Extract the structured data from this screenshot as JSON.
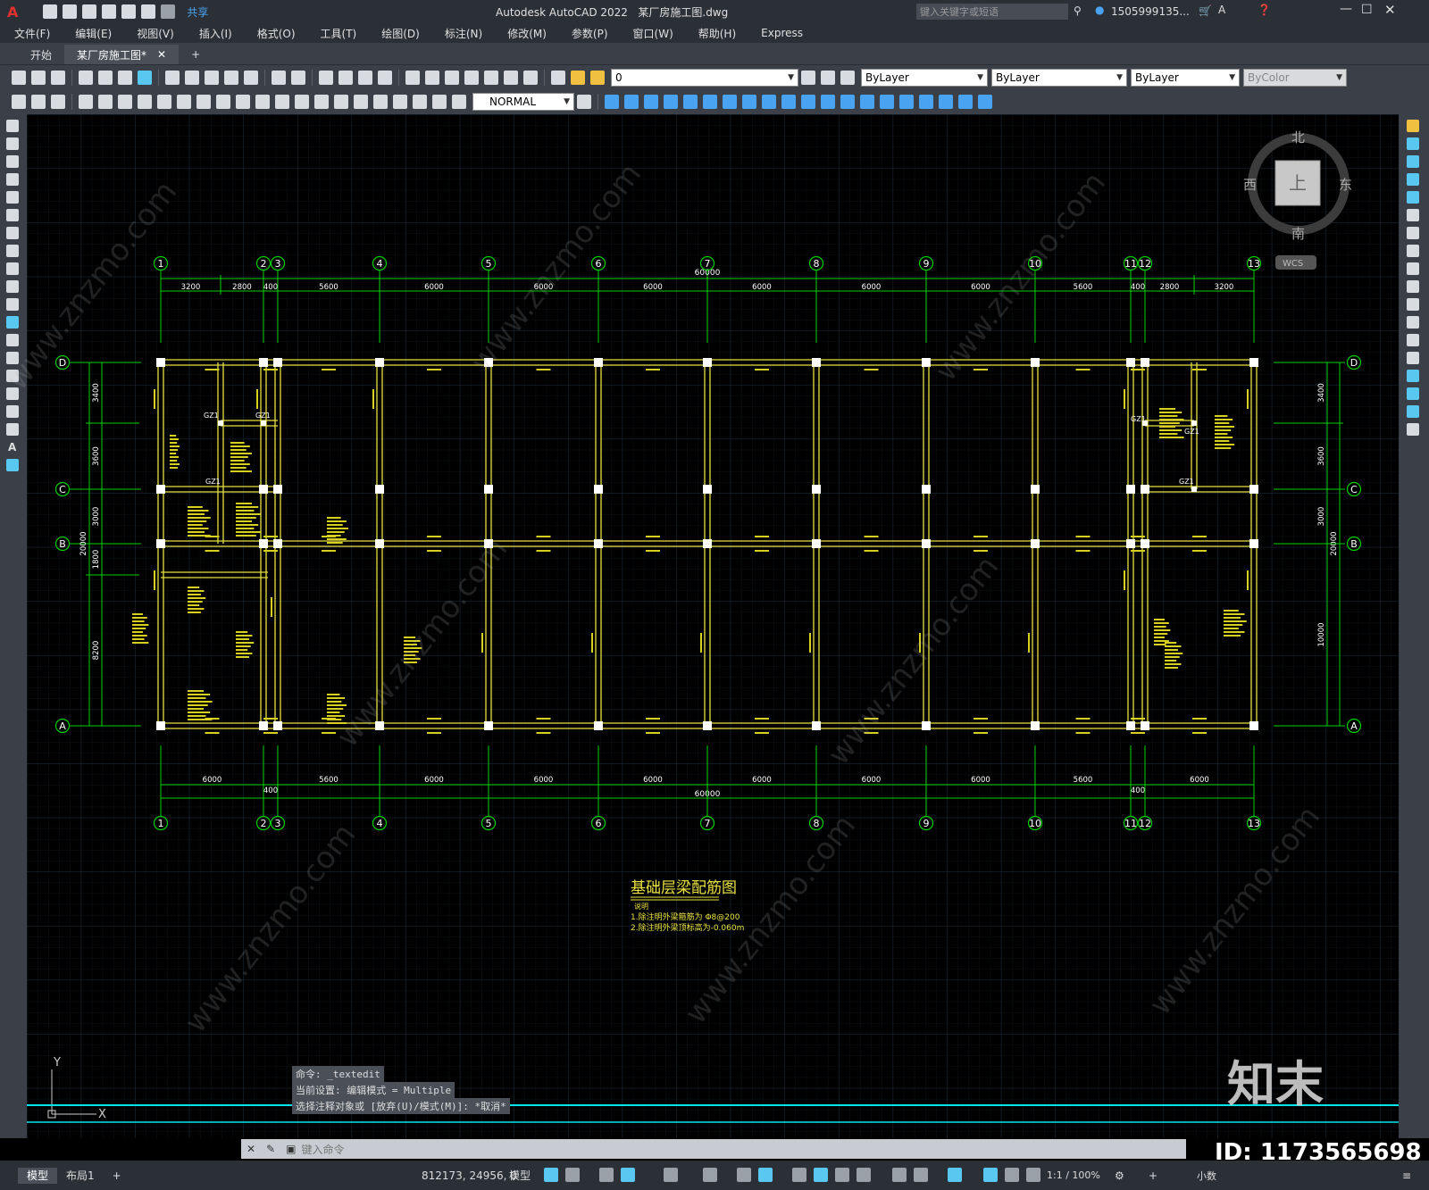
{
  "app": {
    "title": "Autodesk AutoCAD 2022",
    "filename": "某厂房施工图.dwg",
    "search_placeholder": "键入关键字或短语",
    "user": "1505999135...",
    "share": "共享"
  },
  "menu": [
    "文件(F)",
    "编辑(E)",
    "视图(V)",
    "插入(I)",
    "格式(O)",
    "工具(T)",
    "绘图(D)",
    "标注(N)",
    "修改(M)",
    "参数(P)",
    "窗口(W)",
    "帮助(H)",
    "Express"
  ],
  "tabs": [
    "开始",
    "某厂房施工图*"
  ],
  "toolbar": {
    "layer": "0",
    "color": "ByLayer",
    "linetype": "ByLayer",
    "lineweight": "ByLayer",
    "plotstyle": "ByColor",
    "textstyle": "NORMAL"
  },
  "viewcube": {
    "north": "北",
    "south": "南",
    "east": "东",
    "west": "西",
    "top": "上",
    "wcs": "WCS"
  },
  "drawing": {
    "grid_labels": [
      "1",
      "2",
      "3",
      "4",
      "5",
      "6",
      "7",
      "8",
      "9",
      "10",
      "11",
      "12",
      "13"
    ],
    "row_labels": [
      "D",
      "C",
      "B",
      "A"
    ],
    "top_dims": [
      "3200",
      "2800",
      "400",
      "5600",
      "6000",
      "6000",
      "6000",
      "6000",
      "6000",
      "6000",
      "5600",
      "400",
      "2800",
      "3200"
    ],
    "bottom_dims": [
      "6000",
      "400",
      "5600",
      "6000",
      "6000",
      "6000",
      "6000",
      "6000",
      "6000",
      "5600",
      "400",
      "6000"
    ],
    "total_dim": "60000",
    "left_dims": [
      "3400",
      "3600",
      "3000",
      "1800",
      "8200"
    ],
    "left_total": "20000",
    "right_dims": [
      "3400",
      "3600",
      "3000",
      "10000"
    ],
    "right_total": "20000",
    "title": "基础层梁配筋图",
    "note_heading": "说明",
    "note1": "1.除注明外梁箍筋为 Φ8@200",
    "note2": "2.除注明外梁顶标高为-0.060m",
    "column_tag": "GZ1"
  },
  "command": {
    "history": [
      "命令: _textedit",
      "当前设置: 编辑模式 = Multiple",
      "选择注释对象或 [放弃(U)/模式(M)]: *取消*"
    ],
    "placeholder": "键入命令"
  },
  "status": {
    "coords": "812173, 24956, 0",
    "model": "模型",
    "scale": "1:1 / 100%",
    "units": "小数"
  },
  "layout_tabs": [
    "模型",
    "布局1"
  ],
  "watermark": {
    "site": "www.znzmo.com",
    "brand": "知末网",
    "logo": "知末",
    "id": "ID: 1173565698"
  },
  "colors": {
    "grid": "#00d000",
    "beam": "#e8e040",
    "annot": "#d8d020",
    "column": "#ffffff",
    "bg": "#000000"
  }
}
